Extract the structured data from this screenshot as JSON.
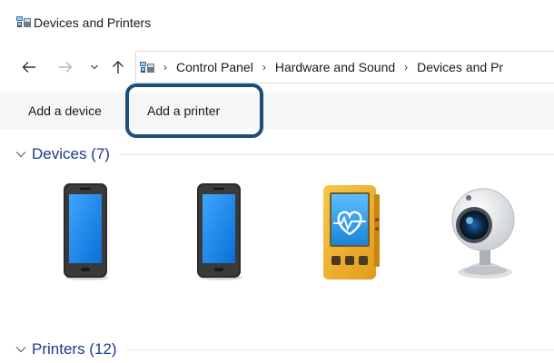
{
  "window": {
    "title": "Devices and Printers"
  },
  "nav": {
    "back_icon": "back-arrow-icon",
    "forward_icon": "forward-arrow-icon",
    "recent_icon": "chevron-down-icon",
    "up_icon": "up-arrow-icon"
  },
  "address_bar": {
    "breadcrumbs": [
      "Control Panel",
      "Hardware and Sound",
      "Devices and Pr"
    ],
    "separator": "›"
  },
  "command_bar": {
    "add_device": "Add a device",
    "add_printer": "Add a printer"
  },
  "groups": {
    "devices": {
      "title": "Devices (7)",
      "items": [
        {
          "icon": "smartphone-icon"
        },
        {
          "icon": "smartphone-icon"
        },
        {
          "icon": "health-monitor-icon"
        },
        {
          "icon": "webcam-icon"
        }
      ]
    },
    "printers": {
      "title": "Printers (12)"
    }
  },
  "colors": {
    "group_title": "#1e3a8a",
    "highlight_ring": "#1d4e7a",
    "command_bar_bg": "#f5f6f7",
    "phone_screen": "#1e90ff",
    "monitor_body": "#f2b431"
  }
}
